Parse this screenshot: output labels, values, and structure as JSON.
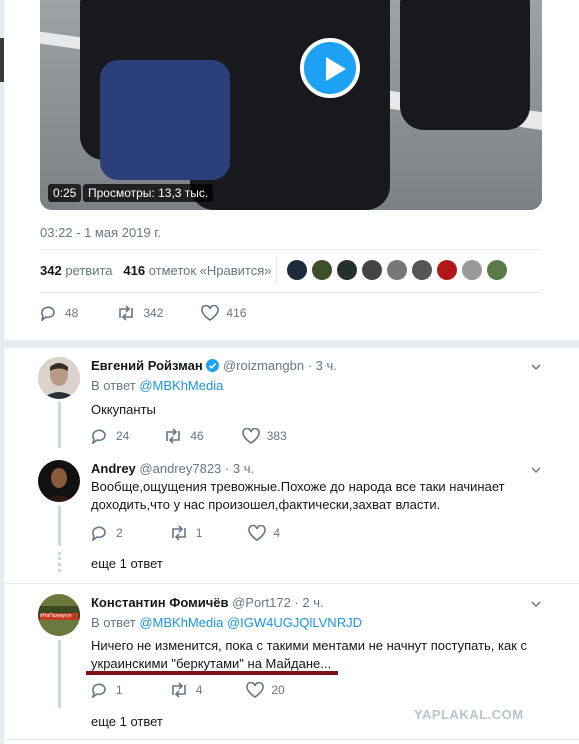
{
  "tweet": {
    "video": {
      "duration": "0:25",
      "views": "Просмотры: 13,3 тыс."
    },
    "timestamp": "03:22 - 1 мая 2019 г.",
    "stats": {
      "retweets_count": "342",
      "retweets_label": "ретвита",
      "likes_count": "416",
      "likes_label": "отметок «Нравится»"
    },
    "liker_avatar_colors": [
      "#1c2a3a",
      "#3a4f2a",
      "#24302a",
      "#444444",
      "#777777",
      "#555555",
      "#b01818",
      "#9a9a9a",
      "#5a7a4a"
    ],
    "actions": {
      "replies": "48",
      "retweets": "342",
      "likes": "416"
    }
  },
  "replies": [
    {
      "name": "Евгений Ройзман",
      "verified": true,
      "handle": "@roizmangbn",
      "time": "· 3 ч.",
      "in_reply_prefix": "В ответ",
      "in_reply_to": "@MBKhMedia",
      "text": "Оккупанты",
      "counts": {
        "replies": "24",
        "retweets": "46",
        "likes": "383"
      }
    },
    {
      "name": "Andrey",
      "handle": "@andrey7823",
      "time": "· 3 ч.",
      "text_line1": "Вообще,ощущения тревожные.Похоже до народа все таки начинает",
      "text_line2": "доходить,что у нас произошел,фактически,захват власти.",
      "counts": {
        "replies": "2",
        "retweets": "1",
        "likes": "4"
      },
      "more": "еще 1 ответ"
    },
    {
      "name": "Константин Фомичёв",
      "handle": "@Port172",
      "time": "· 2 ч.",
      "in_reply_prefix": "В ответ",
      "in_reply_to": "@MBKhMedia @IGW4UGJQlLVNRJD",
      "text_line1": "Ничего не изменится, пока с такими ментами не начнут поступать, как с",
      "text_line2": "украинскими \"беркутами\" на Майдане...",
      "avatar_tag": "#НаПалмугун",
      "counts": {
        "replies": "1",
        "retweets": "4",
        "likes": "20"
      },
      "more": "еще 1 ответ"
    }
  ],
  "watermark": "YAPLAKAL.COM"
}
